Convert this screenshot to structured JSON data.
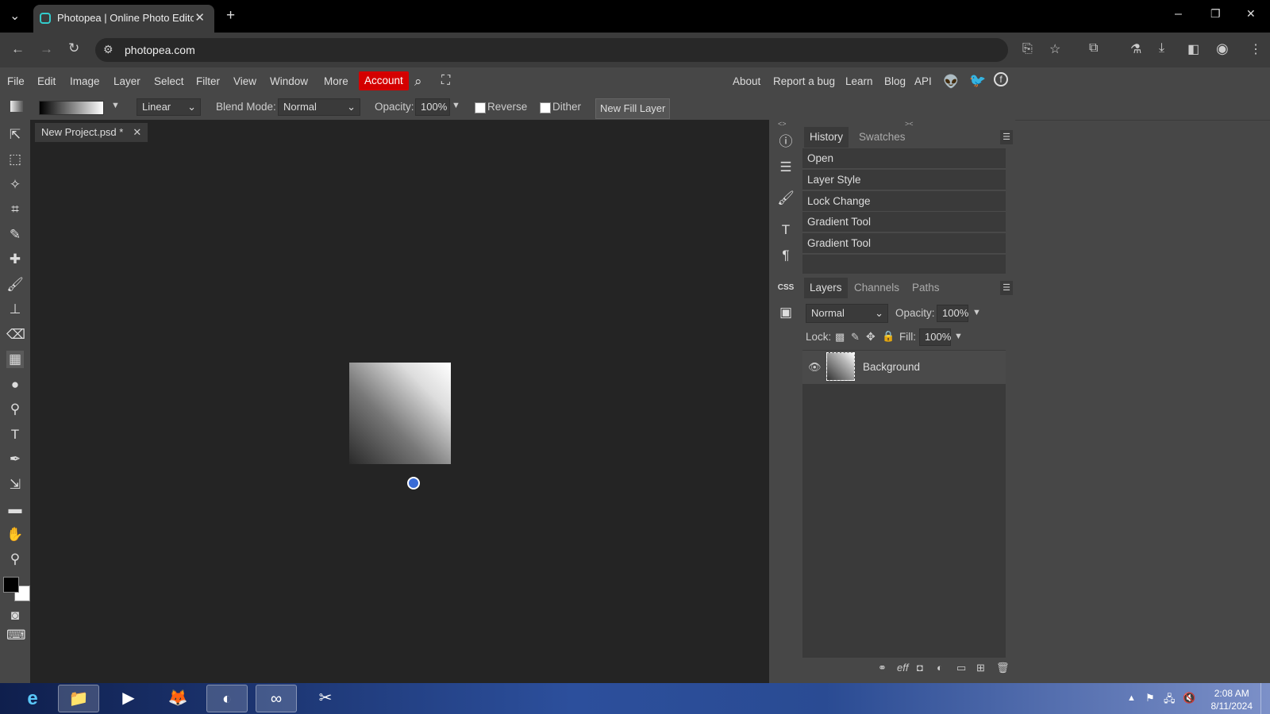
{
  "browser": {
    "tab_title": "Photopea | Online Photo Editor",
    "new_tab": "+",
    "url": "photopea.com",
    "window_controls": [
      "–",
      "❐",
      "✕"
    ]
  },
  "menubar": {
    "items": [
      "File",
      "Edit",
      "Image",
      "Layer",
      "Select",
      "Filter",
      "View",
      "Window",
      "More"
    ],
    "account": "Account",
    "right_links": [
      "About",
      "Report a bug",
      "Learn",
      "Blog",
      "API"
    ]
  },
  "options": {
    "gradient_type": "Linear",
    "blend_label": "Blend Mode:",
    "blend_value": "Normal",
    "opacity_label": "Opacity:",
    "opacity_value": "100%",
    "reverse_label": "Reverse",
    "dither_label": "Dither",
    "new_fill_layer": "New Fill Layer"
  },
  "document": {
    "tab_title": "New Project.psd *"
  },
  "history_panel": {
    "tabs": [
      "History",
      "Swatches"
    ],
    "items": [
      "Open",
      "Layer Style",
      "Lock Change",
      "Gradient Tool",
      "Gradient Tool"
    ]
  },
  "layers_panel": {
    "tabs": [
      "Layers",
      "Channels",
      "Paths"
    ],
    "blend_mode": "Normal",
    "opacity_label": "Opacity:",
    "opacity_value": "100%",
    "lock_label": "Lock:",
    "fill_label": "Fill:",
    "fill_value": "100%",
    "layers": [
      "Background"
    ]
  },
  "taskbar": {
    "time": "2:08 AM",
    "date": "8/11/2024"
  },
  "colors": {
    "account_red": "#d40000",
    "workspace": "#242424",
    "panel": "#474747",
    "panel_dark": "#3a3a3a"
  }
}
